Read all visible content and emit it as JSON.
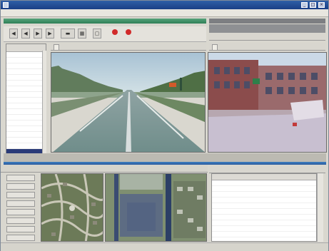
{
  "window": {
    "title": "",
    "minimize": "_",
    "maximize": "□",
    "close": "×"
  },
  "toolbar": {
    "tools": [
      "◀",
      "◀",
      "▶",
      "▶",
      "▬",
      "▦",
      "▢"
    ],
    "rec_labels": [
      "",
      ""
    ]
  },
  "left_list": {
    "header": "",
    "rows": [
      "",
      "",
      "",
      "",
      "",
      "",
      "",
      "",
      "",
      "",
      "",
      "",
      "",
      "",
      "",
      "",
      "",
      "",
      "",
      ""
    ],
    "selected_index": 17
  },
  "views": {
    "front_tab": "",
    "side_tab": ""
  },
  "map": {
    "buttons": [
      "",
      "",
      "",
      "",
      "",
      "",
      "",
      ""
    ]
  },
  "properties": {
    "header_key": "",
    "header_value": "",
    "rows": [
      "",
      "",
      "",
      "",
      "",
      "",
      "",
      "",
      "",
      "",
      "",
      ""
    ]
  },
  "status": {
    "text": ""
  },
  "colors": {
    "accent": "#2f5fa6",
    "panel_green": "#3f8f66",
    "selection": "#2a3b78"
  }
}
